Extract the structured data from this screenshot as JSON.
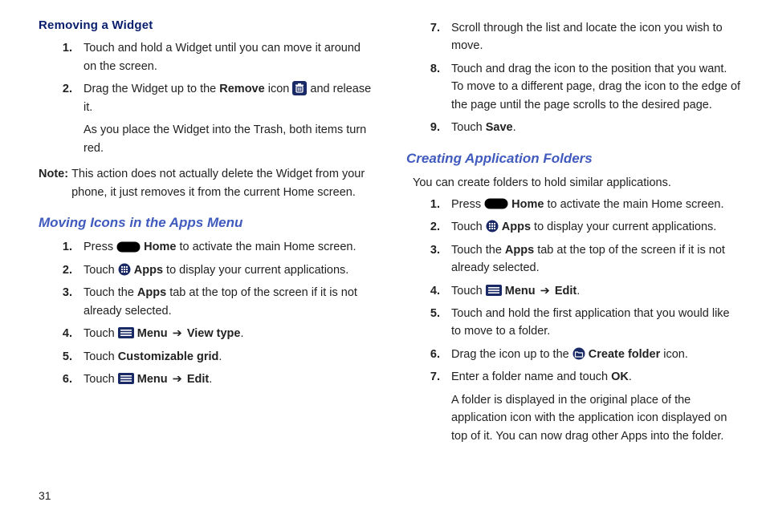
{
  "pageNumber": "31",
  "left": {
    "removing": {
      "heading": "Removing a Widget",
      "steps": [
        {
          "num": "1.",
          "text": "Touch and hold a Widget until you can move it around on the screen."
        },
        {
          "num": "2.",
          "pre": "Drag the Widget up to the ",
          "bold": "Remove",
          "mid": " icon ",
          "post": " and release it.",
          "sub": "As you place the Widget into the Trash, both items turn red."
        }
      ],
      "noteLabel": "Note:",
      "noteText": "This action does not actually delete the Widget from your phone, it just removes it from the current Home screen."
    },
    "moving": {
      "heading": "Moving Icons in the Apps Menu",
      "steps": [
        {
          "num": "1.",
          "pre": "Press ",
          "bold": "Home",
          "post": " to activate the main Home screen."
        },
        {
          "num": "2.",
          "pre": "Touch ",
          "bold": "Apps",
          "post": " to display your current applications."
        },
        {
          "num": "3.",
          "pre": "Touch the ",
          "bold": "Apps",
          "post": " tab at the top of the screen if it is not already selected."
        },
        {
          "num": "4.",
          "pre": "Touch ",
          "bold1": "Menu",
          "arrow": " ➔ ",
          "bold2": "View type",
          "post": "."
        },
        {
          "num": "5.",
          "pre": "Touch ",
          "bold": "Customizable grid",
          "post": "."
        },
        {
          "num": "6.",
          "pre": "Touch ",
          "bold1": "Menu",
          "arrow": " ➔ ",
          "bold2": "Edit",
          "post": "."
        }
      ]
    }
  },
  "right": {
    "cont": [
      {
        "num": "7.",
        "text": "Scroll through the list and locate the icon you wish to move."
      },
      {
        "num": "8.",
        "text": "Touch and drag the icon to the position that you want. To move to a different page, drag the icon to the edge of the page until the page scrolls to the desired page."
      },
      {
        "num": "9.",
        "pre": "Touch ",
        "bold": "Save",
        "post": "."
      }
    ],
    "folders": {
      "heading": "Creating Application Folders",
      "intro": "You can create folders to hold similar applications.",
      "steps": [
        {
          "num": "1.",
          "pre": "Press ",
          "bold": "Home",
          "post": " to activate the main Home screen."
        },
        {
          "num": "2.",
          "pre": "Touch ",
          "bold": "Apps",
          "post": " to display your current applications."
        },
        {
          "num": "3.",
          "pre": "Touch the ",
          "bold": "Apps",
          "post": " tab at the top of the screen if it is not already selected."
        },
        {
          "num": "4.",
          "pre": "Touch ",
          "bold1": "Menu",
          "arrow": " ➔ ",
          "bold2": "Edit",
          "post": "."
        },
        {
          "num": "5.",
          "text": "Touch and hold the first application that you would like to move to a folder."
        },
        {
          "num": "6.",
          "pre": "Drag the icon up to the ",
          "bold": "Create folder",
          "post": " icon."
        },
        {
          "num": "7.",
          "pre": "Enter a folder name and touch ",
          "bold": "OK",
          "post": ".",
          "sub": "A folder is displayed in the original place of the application icon with the application icon displayed on top of it. You can now drag other Apps into the folder."
        }
      ]
    }
  }
}
